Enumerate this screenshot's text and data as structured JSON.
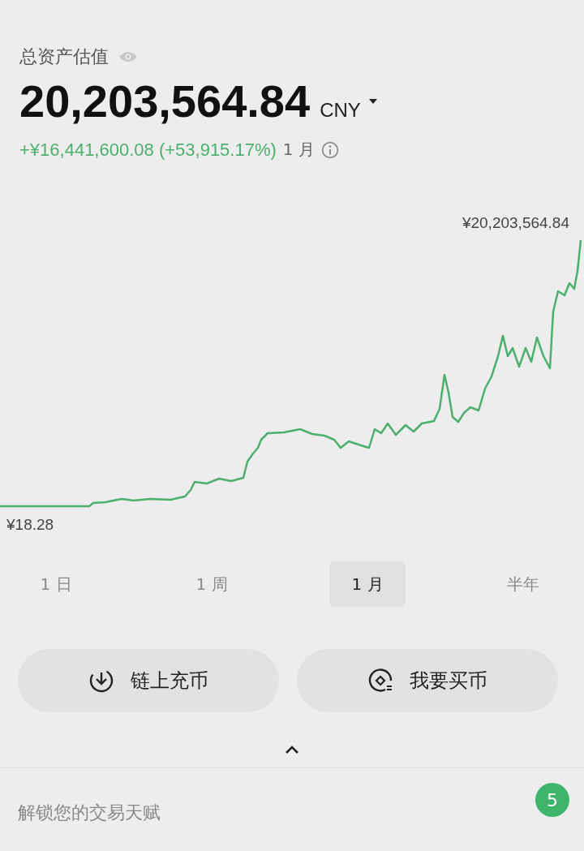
{
  "summary": {
    "label": "总资产估值",
    "amount": "20,203,564.84",
    "currency": "CNY",
    "change": "+¥16,441,600.08 (+53,915.17%)",
    "period": "1 月"
  },
  "chart": {
    "high_label": "¥20,203,564.84",
    "low_label": "¥18.28"
  },
  "periods": [
    {
      "label": "1 日",
      "selected": false
    },
    {
      "label": "1 周",
      "selected": false
    },
    {
      "label": "1 月",
      "selected": true
    },
    {
      "label": "半年",
      "selected": false
    }
  ],
  "actions": [
    {
      "label": "链上充币",
      "kind": "deposit"
    },
    {
      "label": "我要买币",
      "kind": "buy"
    }
  ],
  "footer": {
    "text": "解锁您的交易天赋",
    "badge": "5"
  }
}
